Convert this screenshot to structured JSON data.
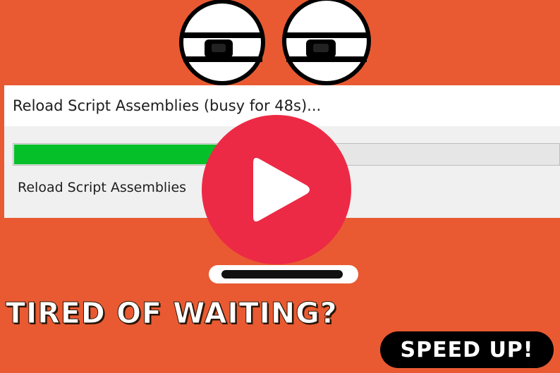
{
  "colors": {
    "background": "#E95A32",
    "progress_fill": "#06C02A",
    "play_button": "#EC2A45",
    "badge": "#000000"
  },
  "dialog": {
    "title": "Reload Script Assemblies (busy for 48s)...",
    "status": "Reload Script Assemblies",
    "progress": 0.38
  },
  "icons": {
    "play": "play-icon",
    "eyes": "eyes-icon"
  },
  "headline": "TIRED OF WAITING?",
  "badge": {
    "label": "SPEED UP!"
  }
}
